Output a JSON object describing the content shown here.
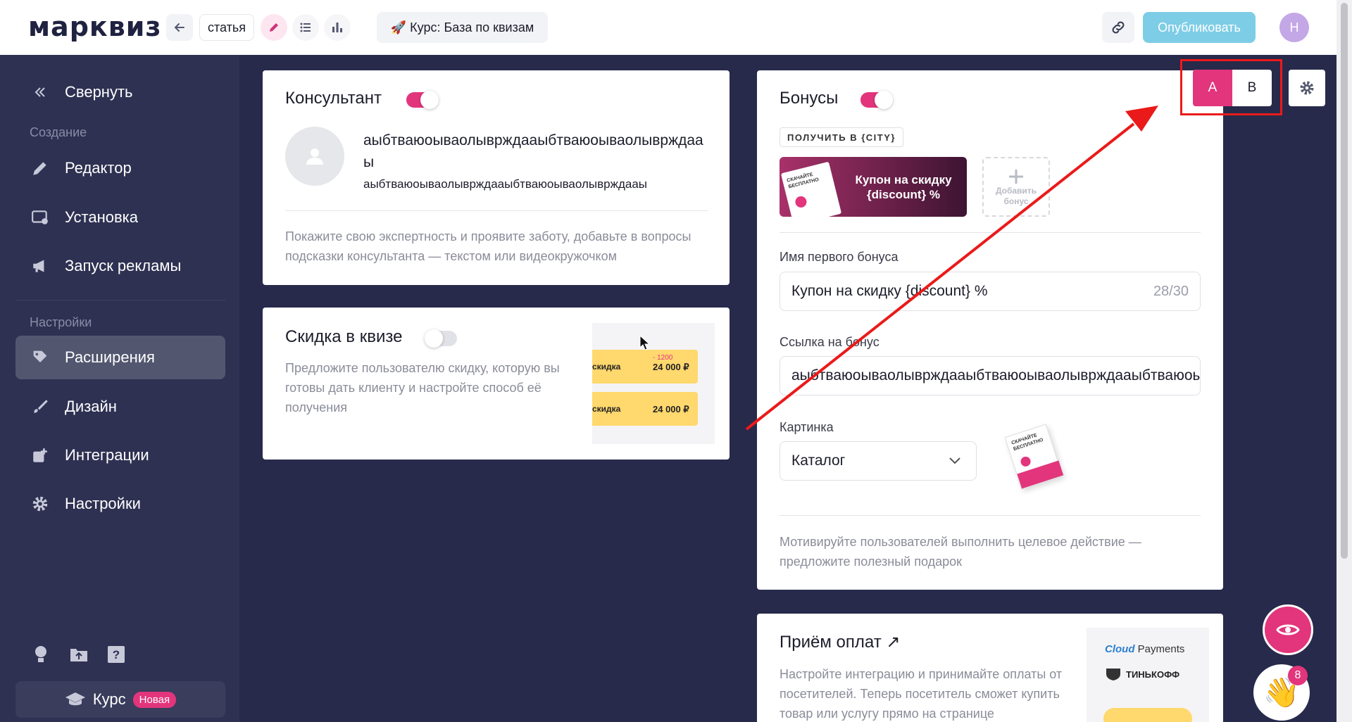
{
  "topbar": {
    "logo": "марквиз",
    "back_icon": "arrow-left-icon",
    "article_label": "статья",
    "quiz_title": "🚀 Курс: База по квизам",
    "publish_label": "Опубликовать",
    "avatar_initial": "Н",
    "accent_color": "#e2357c",
    "publish_color": "#7ecde6"
  },
  "sidebar": {
    "collapse_label": "Свернуть",
    "section_create": "Создание",
    "section_settings": "Настройки",
    "items": [
      {
        "label": "Редактор",
        "icon": "pencil-icon"
      },
      {
        "label": "Установка",
        "icon": "install-icon"
      },
      {
        "label": "Запуск рекламы",
        "icon": "megaphone-icon"
      },
      {
        "label": "Расширения",
        "icon": "puzzle-icon"
      },
      {
        "label": "Дизайн",
        "icon": "brush-icon"
      },
      {
        "label": "Интеграции",
        "icon": "integrations-icon"
      },
      {
        "label": "Настройки",
        "icon": "gear-icon"
      }
    ],
    "course_label": "Курс",
    "course_badge": "Новая"
  },
  "consultant": {
    "title": "Консультант",
    "enabled": true,
    "name": "аыбтваюоываолыврждааыбтваюоываолыврждааы",
    "subtitle": "аыбтваюоываолыврждааыбтваюоываолыврждааы",
    "description": "Покажите свою экспертность и проявите заботу, добавьте в вопросы подсказки консультанта — текстом или видеокружочком"
  },
  "discount": {
    "title": "Скидка в квизе",
    "enabled": false,
    "description": "Предложите пользователю скидку, которую вы готовы дать клиенту и настройте способ её получения",
    "preview_label": "скидка",
    "preview_price": "24 000 ₽",
    "preview_old": "- 1200"
  },
  "bonuses": {
    "title": "Бонусы",
    "enabled": true,
    "tag": "ПОЛУЧИТЬ В {CITY}",
    "bonus_card_title": "Купон на скидку {discount} %",
    "bonus_card_image_text": "СКАЧАЙТЕ БЕСПЛАТНО",
    "add_bonus_label": "Добавить бонус",
    "name_label": "Имя первого бонуса",
    "name_value": "Купон на скидку {discount} %",
    "name_counter": "28/30",
    "link_label": "Ссылка на бонус",
    "link_value": "аыбтваюоываолыврждааыбтваюоываолыврждааыбтваюоываолыврждааы",
    "image_label": "Картинка",
    "image_select": "Каталог",
    "description": "Мотивируйте пользователей выполнить целевое действие — предложите полезный подарок"
  },
  "ab": {
    "a": "A",
    "b": "B"
  },
  "payments": {
    "title": "Приём оплат ↗",
    "description": "Настройте интеграцию и принимайте оплаты от посетителей. Теперь посетитель сможет купить товар или услугу прямо на странице",
    "logo_cloud": "Cloud",
    "logo_payments": "Payments",
    "logo_tinkoff": "ТИНЬКОФФ"
  },
  "notifications": {
    "count": "8"
  }
}
